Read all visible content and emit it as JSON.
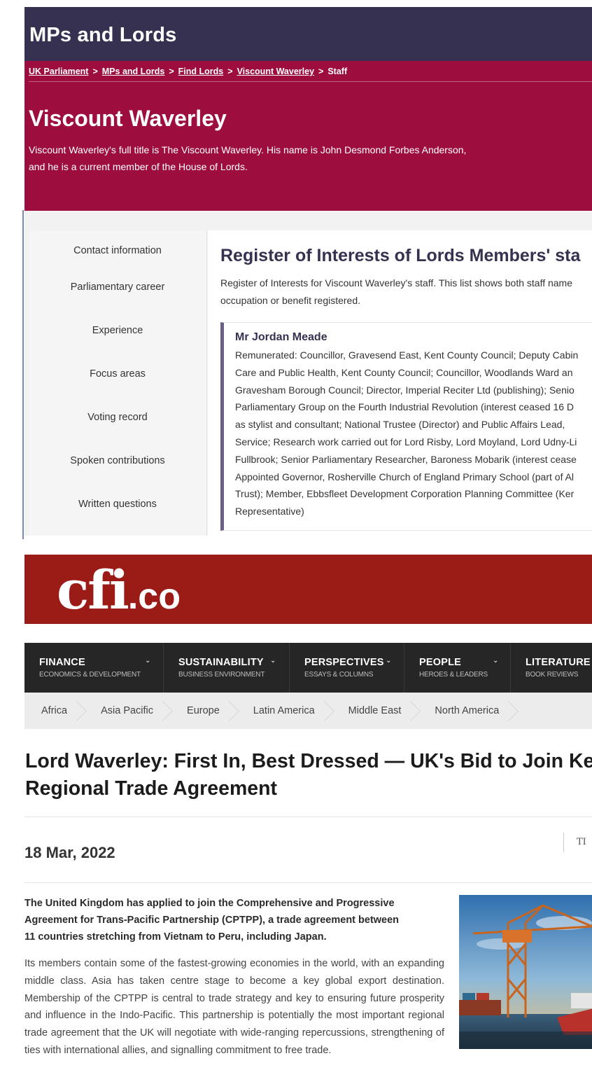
{
  "parliament": {
    "site_name": "MPs and Lords",
    "breadcrumbs": [
      "UK Parliament",
      "MPs and Lords",
      "Find Lords",
      "Viscount Waverley"
    ],
    "breadcrumb_current": "Staff",
    "breadcrumb_separator": ">",
    "lord_name": "Viscount Waverley",
    "lord_desc_line1": "Viscount Waverley's full title is The Viscount Waverley. His name is John Desmond Forbes Anderson,",
    "lord_desc_line2": "and he is a current member of the House of Lords.",
    "side_nav": [
      "Contact information",
      "Parliamentary career",
      "Experience",
      "Focus areas",
      "Voting record",
      "Spoken contributions",
      "Written questions"
    ],
    "register_title": "Register of Interests of Lords Members' sta",
    "register_intro_line1": "Register of Interests for Viscount Waverley's staff. This list shows both staff name",
    "register_intro_line2": "occupation or benefit registered.",
    "staff_name": "Mr Jordan Meade",
    "staff_lines": [
      "Remunerated: Councillor, Gravesend East, Kent County Council; Deputy Cabin",
      "Care and Public Health, Kent County Council; Councillor, Woodlands Ward an",
      "Gravesham Borough Council; Director, Imperial Reciter Ltd (publishing); Senio",
      "Parliamentary Group on the Fourth Industrial Revolution (interest ceased 16 D",
      "as stylist and consultant; National Trustee (Director) and Public Affairs Lead,",
      "Service; Research work carried out for Lord Risby, Lord Moyland, Lord Udny-Li",
      "Fullbrook; Senior Parliamentary Researcher, Baroness Mobarik (interest cease",
      "Appointed Governor, Rosherville Church of England Primary School (part of Al",
      "Trust); Member, Ebbsfleet Development Corporation Planning Committee (Ker",
      "Representative)"
    ]
  },
  "cfi": {
    "logo_main": "cfi",
    "logo_tld": ".co",
    "nav": [
      {
        "title": "FINANCE",
        "sub": "ECONOMICS & DEVELOPMENT",
        "caret": "⌄"
      },
      {
        "title": "SUSTAINABILITY",
        "sub": "BUSINESS ENVIRONMENT",
        "caret": "⌄"
      },
      {
        "title": "PERSPECTIVES",
        "sub": "ESSAYS & COLUMNS",
        "caret": "⌄"
      },
      {
        "title": "PEOPLE",
        "sub": "HEROES & LEADERS",
        "caret": "⌄"
      },
      {
        "title": "LITERATURE",
        "sub": "BOOK REVIEWS",
        "caret": ""
      }
    ],
    "regions": [
      "Africa",
      "Asia Pacific",
      "Europe",
      "Latin America",
      "Middle East",
      "North America"
    ],
    "article_title_line1": "Lord Waverley: First In, Best Dressed — UK's Bid to Join Ke",
    "article_title_line2": "Regional Trade Agreement",
    "date": "18 Mar, 2022",
    "meta_cut": "TI",
    "lead_lines": [
      "The United Kingdom has applied to join the Comprehensive and Progressive",
      "Agreement for Trans-Pacific Partnership (CPTPP), a trade agreement between",
      "11 countries stretching from Vietnam to Peru, including Japan."
    ],
    "body": "Its members contain some of the fastest-growing economies in the world, with an expanding middle class. Asia has taken centre stage to become a key global export destination. Membership of the CPTPP is central to trade strategy and key to ensuring future prosperity and influence in the Indo-Pacific. This partnership is potentially the most important regional trade agreement that the UK will negotiate with wide-ranging repercussions, strengthening of ties with international allies, and signalling commitment to free trade."
  },
  "colors": {
    "parliament_topbar": "#373151",
    "parliament_hero": "#9d0e3f",
    "cfi_header": "#9b1b17",
    "cfi_nav": "#262626"
  }
}
